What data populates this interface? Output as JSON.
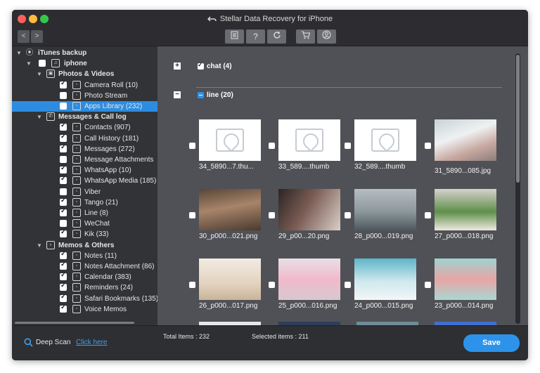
{
  "window": {
    "title": "Stellar Data Recovery for iPhone"
  },
  "toolbar": {
    "back_label": "<",
    "forward_label": ">",
    "help_label": "?"
  },
  "tree": {
    "root": "iTunes backup",
    "device": "iphone",
    "groups": [
      {
        "label": "Photos & Videos",
        "items": [
          {
            "label": "Camera Roll (10)",
            "checked": true,
            "icon": "flower-icon"
          },
          {
            "label": "Photo Stream",
            "checked": false,
            "icon": "photo-stream-icon"
          },
          {
            "label": "Apps Library (232)",
            "checked": false,
            "selected": true,
            "icon": "apps-library-icon"
          }
        ]
      },
      {
        "label": "Messages & Call log",
        "items": [
          {
            "label": "Contacts (907)",
            "checked": true,
            "icon": "contacts-icon"
          },
          {
            "label": "Call History (181)",
            "checked": true,
            "icon": "phone-icon"
          },
          {
            "label": "Messages (272)",
            "checked": true,
            "icon": "message-bubble-icon"
          },
          {
            "label": "Message Attachments",
            "checked": false,
            "icon": "attachment-icon"
          },
          {
            "label": "WhatsApp (10)",
            "checked": true,
            "icon": "whatsapp-icon"
          },
          {
            "label": "WhatsApp Media (185)",
            "checked": true,
            "icon": "whatsapp-media-icon"
          },
          {
            "label": "Viber",
            "checked": false,
            "icon": "viber-icon"
          },
          {
            "label": "Tango (21)",
            "checked": true,
            "icon": "tango-icon"
          },
          {
            "label": "Line (8)",
            "checked": true,
            "icon": "line-icon"
          },
          {
            "label": "WeChat",
            "checked": false,
            "icon": "wechat-icon"
          },
          {
            "label": "Kik (33)",
            "checked": true,
            "icon": "kik-icon"
          }
        ]
      },
      {
        "label": "Memos & Others",
        "items": [
          {
            "label": "Notes (11)",
            "checked": true,
            "icon": "notes-icon"
          },
          {
            "label": "Notes Attachment (86)",
            "checked": true,
            "icon": "notes-attachment-icon"
          },
          {
            "label": "Calendar (383)",
            "checked": true,
            "icon": "calendar-icon"
          },
          {
            "label": "Reminders (24)",
            "checked": true,
            "icon": "reminders-icon"
          },
          {
            "label": "Safari Bookmarks (135)",
            "checked": true,
            "icon": "safari-icon"
          },
          {
            "label": "Voice Memos",
            "checked": true,
            "icon": "voice-memo-icon"
          }
        ]
      }
    ]
  },
  "main": {
    "groups": [
      {
        "label": "chat (4)",
        "expand_symbol": "+",
        "checked": true
      },
      {
        "label": "line (20)",
        "expand_symbol": "−",
        "checked": "partial"
      }
    ],
    "tiles": [
      {
        "filename": "34_5890...7.thu...",
        "kind": "placeholder"
      },
      {
        "filename": "33_589....thumb",
        "kind": "placeholder"
      },
      {
        "filename": "32_589....thumb",
        "kind": "placeholder"
      },
      {
        "filename": "31_5890...085.jpg",
        "kind": "teacup"
      },
      {
        "filename": "30_p000...021.png",
        "kind": "room"
      },
      {
        "filename": "29_p00...20.png",
        "kind": "dark-still"
      },
      {
        "filename": "28_p000...019.png",
        "kind": "city-rain"
      },
      {
        "filename": "27_p000...018.png",
        "kind": "plant"
      },
      {
        "filename": "26_p000...017.png",
        "kind": "cake"
      },
      {
        "filename": "25_p000...016.png",
        "kind": "flower"
      },
      {
        "filename": "24_p000...015.png",
        "kind": "clouds"
      },
      {
        "filename": "23_p000...014.png",
        "kind": "balloons"
      }
    ]
  },
  "footer": {
    "deep_scan_label": "Deep Scan",
    "deep_scan_link": "Click here",
    "total_items": "Total Items : 232",
    "selected_items": "Selected items : 211",
    "save_label": "Save"
  },
  "colors": {
    "accent": "#2d93ea",
    "selection": "#2d8ce0",
    "sidebar_bg": "#323337",
    "content_bg": "#505156"
  }
}
